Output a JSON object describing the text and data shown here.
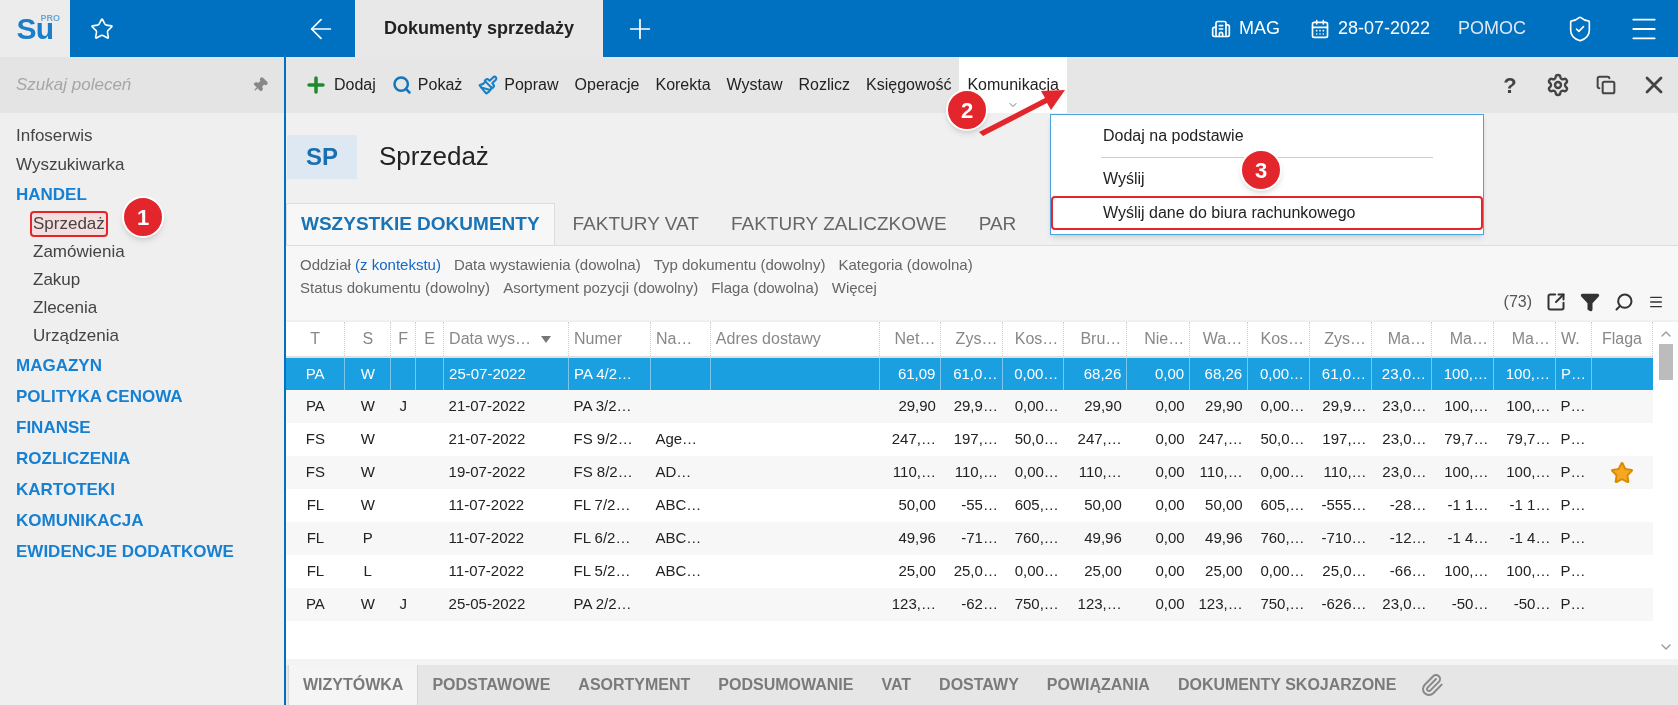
{
  "app": {
    "logo": "Su",
    "logo_badge": "PRO"
  },
  "top_bar": {
    "document_tab": "Dokumenty sprzedaży",
    "warehouse": "MAG",
    "date": "28-07-2022",
    "help": "POMOC"
  },
  "sidebar": {
    "search": {
      "placeholder": "Szukaj poleceń"
    },
    "items": [
      {
        "label": "Infoserwis",
        "kind": "link"
      },
      {
        "label": "Wyszukiwarka",
        "kind": "link"
      },
      {
        "label": "HANDEL",
        "kind": "section",
        "children": [
          {
            "label": "Sprzedaż",
            "highlighted": true
          },
          {
            "label": "Zamówienia",
            "highlighted": false
          },
          {
            "label": "Zakup",
            "highlighted": false
          },
          {
            "label": "Zlecenia",
            "highlighted": false
          },
          {
            "label": "Urządzenia",
            "highlighted": false
          }
        ]
      },
      {
        "label": "MAGAZYN",
        "kind": "section"
      },
      {
        "label": "POLITYKA CENOWA",
        "kind": "section"
      },
      {
        "label": "FINANSE",
        "kind": "section"
      },
      {
        "label": "ROZLICZENIA",
        "kind": "section"
      },
      {
        "label": "KARTOTEKI",
        "kind": "section"
      },
      {
        "label": "KOMUNIKACJA",
        "kind": "section"
      },
      {
        "label": "EWIDENCJE DODATKOWE",
        "kind": "section"
      }
    ]
  },
  "toolbar": {
    "items": [
      {
        "label": "Dodaj",
        "kind": "add"
      },
      {
        "label": "Pokaż",
        "kind": "show"
      },
      {
        "label": "Popraw",
        "kind": "edit"
      },
      {
        "label": "Operacje",
        "kind": "menu",
        "open": false
      },
      {
        "label": "Korekta",
        "kind": "menu",
        "open": false
      },
      {
        "label": "Wystaw",
        "kind": "menu",
        "open": false
      },
      {
        "label": "Rozlicz",
        "kind": "menu",
        "open": false
      },
      {
        "label": "Księgowość",
        "kind": "menu",
        "open": false
      },
      {
        "label": "Komunikacja",
        "kind": "menu",
        "open": true
      }
    ],
    "help": "?"
  },
  "dropdown": {
    "items": [
      {
        "kind": "item",
        "label": "Dodaj na podstawie",
        "highlighted": false
      },
      {
        "kind": "separator"
      },
      {
        "kind": "item",
        "label": "Wyślij",
        "highlighted": false
      },
      {
        "kind": "item",
        "label": "Wyślij dane do biura rachunkowego",
        "highlighted": true
      }
    ]
  },
  "page": {
    "badge": "SP",
    "title": "Sprzedaż"
  },
  "tabs": [
    {
      "label": "WSZYSTKIE DOKUMENTY",
      "selected": true
    },
    {
      "label": "FAKTURY VAT",
      "selected": false
    },
    {
      "label": "FAKTURY ZALICZKOWE",
      "selected": false
    },
    {
      "label": "PAR",
      "selected": false
    }
  ],
  "filter_rows": [
    {
      "filters": [
        {
          "kind": "filter",
          "label": "Oddział",
          "value": "(z kontekstu)",
          "set": true
        },
        {
          "kind": "filter",
          "label": "Data wystawienia",
          "value": "(dowolna)",
          "set": false
        },
        {
          "kind": "filter",
          "label": "Typ dokumentu",
          "value": "(dowolny)",
          "set": false
        },
        {
          "kind": "filter",
          "label": "Kategoria",
          "value": "(dowolna)",
          "set": false
        }
      ]
    },
    {
      "filters": [
        {
          "kind": "filter",
          "label": "Status dokumentu",
          "value": "(dowolny)",
          "set": false
        },
        {
          "kind": "filter",
          "label": "Asortyment pozycji",
          "value": "(dowolny)",
          "set": false
        },
        {
          "kind": "filter",
          "label": "Flaga",
          "value": "(dowolna)",
          "set": false
        },
        {
          "kind": "link",
          "label": "Więcej"
        }
      ]
    }
  ],
  "record_count": "(73)",
  "table": {
    "columns": [
      {
        "label": "T",
        "kind": "center",
        "sorted": false
      },
      {
        "label": "S",
        "kind": "center",
        "sorted": false
      },
      {
        "label": "F",
        "kind": "center",
        "sorted": false
      },
      {
        "label": "E",
        "kind": "center",
        "sorted": false
      },
      {
        "label": "Data wys…",
        "kind": "text",
        "sorted": true
      },
      {
        "label": "Numer",
        "kind": "text",
        "sorted": false
      },
      {
        "label": "Na…",
        "kind": "text",
        "sorted": false
      },
      {
        "label": "Adres dostawy",
        "kind": "text",
        "sorted": false
      },
      {
        "label": "Net…",
        "kind": "number",
        "sorted": false
      },
      {
        "label": "Zys…",
        "kind": "number",
        "sorted": false
      },
      {
        "label": "Kos…",
        "kind": "number",
        "sorted": false
      },
      {
        "label": "Bru…",
        "kind": "number",
        "sorted": false
      },
      {
        "label": "Nie…",
        "kind": "number",
        "sorted": false
      },
      {
        "label": "Wa…",
        "kind": "number",
        "sorted": false
      },
      {
        "label": "Kos…",
        "kind": "number",
        "sorted": false
      },
      {
        "label": "Zys…",
        "kind": "number",
        "sorted": false
      },
      {
        "label": "Ma…",
        "kind": "number",
        "sorted": false
      },
      {
        "label": "Ma…",
        "kind": "number",
        "sorted": false
      },
      {
        "label": "Ma…",
        "kind": "number",
        "sorted": false
      },
      {
        "label": "W.",
        "kind": "text",
        "sorted": false
      },
      {
        "label": "Flaga",
        "kind": "center",
        "sorted": false
      }
    ],
    "rows": [
      {
        "selected": true,
        "flagged": false,
        "cells": [
          "PA",
          "W",
          null,
          null,
          "25-07-2022",
          "PA 4/2…",
          null,
          null,
          "61,09",
          "61,0…",
          "0,00…",
          "68,26",
          "0,00",
          "68,26",
          "0,00…",
          "61,0…",
          "23,0…",
          "100,…",
          "100,…",
          "P…"
        ]
      },
      {
        "selected": false,
        "flagged": false,
        "cells": [
          "PA",
          "W",
          "J",
          null,
          "21-07-2022",
          "PA 3/2…",
          null,
          null,
          "29,90",
          "29,9…",
          "0,00…",
          "29,90",
          "0,00",
          "29,90",
          "0,00…",
          "29,9…",
          "23,0…",
          "100,…",
          "100,…",
          "P…"
        ]
      },
      {
        "selected": false,
        "flagged": false,
        "cells": [
          "FS",
          "W",
          null,
          null,
          "21-07-2022",
          "FS 9/2…",
          "Age…",
          null,
          "247,…",
          "197,…",
          "50,0…",
          "247,…",
          "0,00",
          "247,…",
          "50,0…",
          "197,…",
          "23,0…",
          "79,7…",
          "79,7…",
          "P…"
        ]
      },
      {
        "selected": false,
        "flagged": true,
        "cells": [
          "FS",
          "W",
          null,
          null,
          "19-07-2022",
          "FS 8/2…",
          "AD…",
          null,
          "110,…",
          "110,…",
          "0,00…",
          "110,…",
          "0,00",
          "110,…",
          "0,00…",
          "110,…",
          "23,0…",
          "100,…",
          "100,…",
          "P…"
        ]
      },
      {
        "selected": false,
        "flagged": false,
        "cells": [
          "FL",
          "W",
          null,
          null,
          "11-07-2022",
          "FL 7/2…",
          "ABC…",
          null,
          "50,00",
          "-55…",
          "605,…",
          "50,00",
          "0,00",
          "50,00",
          "605,…",
          "-555…",
          "-28…",
          "-1 1…",
          "-1 1…",
          "P…"
        ]
      },
      {
        "selected": false,
        "flagged": false,
        "cells": [
          "FL",
          "P",
          null,
          null,
          "11-07-2022",
          "FL 6/2…",
          "ABC…",
          null,
          "49,96",
          "-71…",
          "760,…",
          "49,96",
          "0,00",
          "49,96",
          "760,…",
          "-710…",
          "-12…",
          "-1 4…",
          "-1 4…",
          "P…"
        ]
      },
      {
        "selected": false,
        "flagged": false,
        "cells": [
          "FL",
          "L",
          null,
          null,
          "11-07-2022",
          "FL 5/2…",
          "ABC…",
          null,
          "25,00",
          "25,0…",
          "0,00…",
          "25,00",
          "0,00",
          "25,00",
          "0,00…",
          "25,0…",
          "-66…",
          "100,…",
          "100,…",
          "P…"
        ]
      },
      {
        "selected": false,
        "flagged": false,
        "cells": [
          "PA",
          "W",
          "J",
          null,
          "25-05-2022",
          "PA 2/2…",
          null,
          null,
          "123,…",
          "-62…",
          "750,…",
          "123,…",
          "0,00",
          "123,…",
          "750,…",
          "-626…",
          "23,0…",
          "-50…",
          "-50…",
          "P…"
        ]
      }
    ]
  },
  "bottom_tabs": [
    {
      "label": "WIZYTÓWKA",
      "selected": true
    },
    {
      "label": "PODSTAWOWE",
      "selected": false
    },
    {
      "label": "ASORTYMENT",
      "selected": false
    },
    {
      "label": "PODSUMOWANIE",
      "selected": false
    },
    {
      "label": "VAT",
      "selected": false
    },
    {
      "label": "DOSTAWY",
      "selected": false
    },
    {
      "label": "POWIĄZANIA",
      "selected": false
    },
    {
      "label": "DOKUMENTY SKOJARZONE",
      "selected": false
    }
  ],
  "annotations": [
    {
      "label": "1"
    },
    {
      "label": "2"
    },
    {
      "label": "3"
    }
  ]
}
